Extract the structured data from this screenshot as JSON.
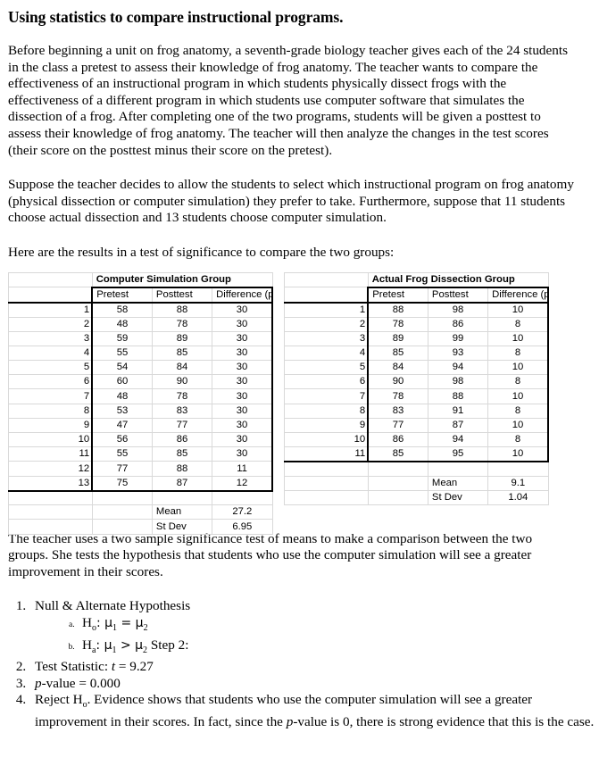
{
  "title": "Using statistics to compare instructional programs.",
  "paragraphs": {
    "intro": "Before beginning a unit on frog anatomy, a seventh-grade biology teacher gives each of the 24 students in the class a pretest to assess their knowledge of frog anatomy. The teacher wants to compare the effectiveness of an instructional program in which students physically dissect frogs with the effectiveness of a different program in which students use computer software that simulates the dissection of a frog. After completing one of the two programs, students will be given a posttest to assess their knowledge of frog anatomy. The teacher will then analyze the changes in the test scores (their score on the posttest minus their score on the pretest).",
    "suppose": "Suppose the teacher decides to allow the students to select which instructional program on frog anatomy (physical dissection or computer simulation) they prefer to take. Furthermore, suppose that 11 students choose actual dissection and 13 students choose computer simulation.",
    "results_lead": "Here are the results in a test of significance to compare the two groups:",
    "two_sample": "The teacher uses a two sample significance test of means to make a comparison between the two groups. She tests the hypothesis that students who use the computer simulation will see a greater improvement in their scores."
  },
  "tables": {
    "left": {
      "group_title": "Computer Simulation Group",
      "headers": [
        "Pretest",
        "Posttest",
        "Difference (posttest-pretest)"
      ],
      "rows": [
        {
          "index": "1",
          "pretest": "58",
          "posttest": "88",
          "difference": "30"
        },
        {
          "index": "2",
          "pretest": "48",
          "posttest": "78",
          "difference": "30"
        },
        {
          "index": "3",
          "pretest": "59",
          "posttest": "89",
          "difference": "30"
        },
        {
          "index": "4",
          "pretest": "55",
          "posttest": "85",
          "difference": "30"
        },
        {
          "index": "5",
          "pretest": "54",
          "posttest": "84",
          "difference": "30"
        },
        {
          "index": "6",
          "pretest": "60",
          "posttest": "90",
          "difference": "30"
        },
        {
          "index": "7",
          "pretest": "48",
          "posttest": "78",
          "difference": "30"
        },
        {
          "index": "8",
          "pretest": "53",
          "posttest": "83",
          "difference": "30"
        },
        {
          "index": "9",
          "pretest": "47",
          "posttest": "77",
          "difference": "30"
        },
        {
          "index": "10",
          "pretest": "56",
          "posttest": "86",
          "difference": "30"
        },
        {
          "index": "11",
          "pretest": "55",
          "posttest": "85",
          "difference": "30"
        },
        {
          "index": "12",
          "pretest": "77",
          "posttest": "88",
          "difference": "11"
        },
        {
          "index": "13",
          "pretest": "75",
          "posttest": "87",
          "difference": "12"
        }
      ],
      "stats": [
        {
          "label": "Mean",
          "value": "27.2"
        },
        {
          "label": "St Dev",
          "value": "6.95"
        }
      ]
    },
    "right": {
      "group_title": "Actual Frog Dissection Group",
      "headers": [
        "Pretest",
        "Posttest",
        "Difference (posttest-pretest)"
      ],
      "rows": [
        {
          "index": "1",
          "pretest": "88",
          "posttest": "98",
          "difference": "10"
        },
        {
          "index": "2",
          "pretest": "78",
          "posttest": "86",
          "difference": "8"
        },
        {
          "index": "3",
          "pretest": "89",
          "posttest": "99",
          "difference": "10"
        },
        {
          "index": "4",
          "pretest": "85",
          "posttest": "93",
          "difference": "8"
        },
        {
          "index": "5",
          "pretest": "84",
          "posttest": "94",
          "difference": "10"
        },
        {
          "index": "6",
          "pretest": "90",
          "posttest": "98",
          "difference": "8"
        },
        {
          "index": "7",
          "pretest": "78",
          "posttest": "88",
          "difference": "10"
        },
        {
          "index": "8",
          "pretest": "83",
          "posttest": "91",
          "difference": "8"
        },
        {
          "index": "9",
          "pretest": "77",
          "posttest": "87",
          "difference": "10"
        },
        {
          "index": "10",
          "pretest": "86",
          "posttest": "94",
          "difference": "8"
        },
        {
          "index": "11",
          "pretest": "85",
          "posttest": "95",
          "difference": "10"
        }
      ],
      "stats": [
        {
          "label": "Mean",
          "value": "9.1"
        },
        {
          "label": "St Dev",
          "value": "1.04"
        }
      ]
    }
  },
  "steps": {
    "item1": "Null & Alternate Hypothesis",
    "item1a_prefix": "H",
    "item1a_sub": "o",
    "item1a_rest": ":  μ",
    "item1a_sub1": "1",
    "item1a_op": " = μ",
    "item1a_sub2": "2",
    "item1b_prefix": "H",
    "item1b_sub": "a",
    "item1b_rest": ":  μ",
    "item1b_sub1": "1",
    "item1b_op": " > μ",
    "item1b_sub2": "2",
    "item1b_tail": " Step 2:",
    "item2_label": "Test Statistic:  ",
    "item2_t": "t",
    "item2_value": " = 9.27",
    "item3_p": "p",
    "item3_value": "-value = 0.000",
    "item4_a": "Reject H",
    "item4_sub": "o",
    "item4_b": ". Evidence shows that students who use the computer simulation will  see a greater improvement in their scores. In fact, since the ",
    "item4_p": "p",
    "item4_c": "-value is 0, there is strong  evidence that this is the case."
  }
}
